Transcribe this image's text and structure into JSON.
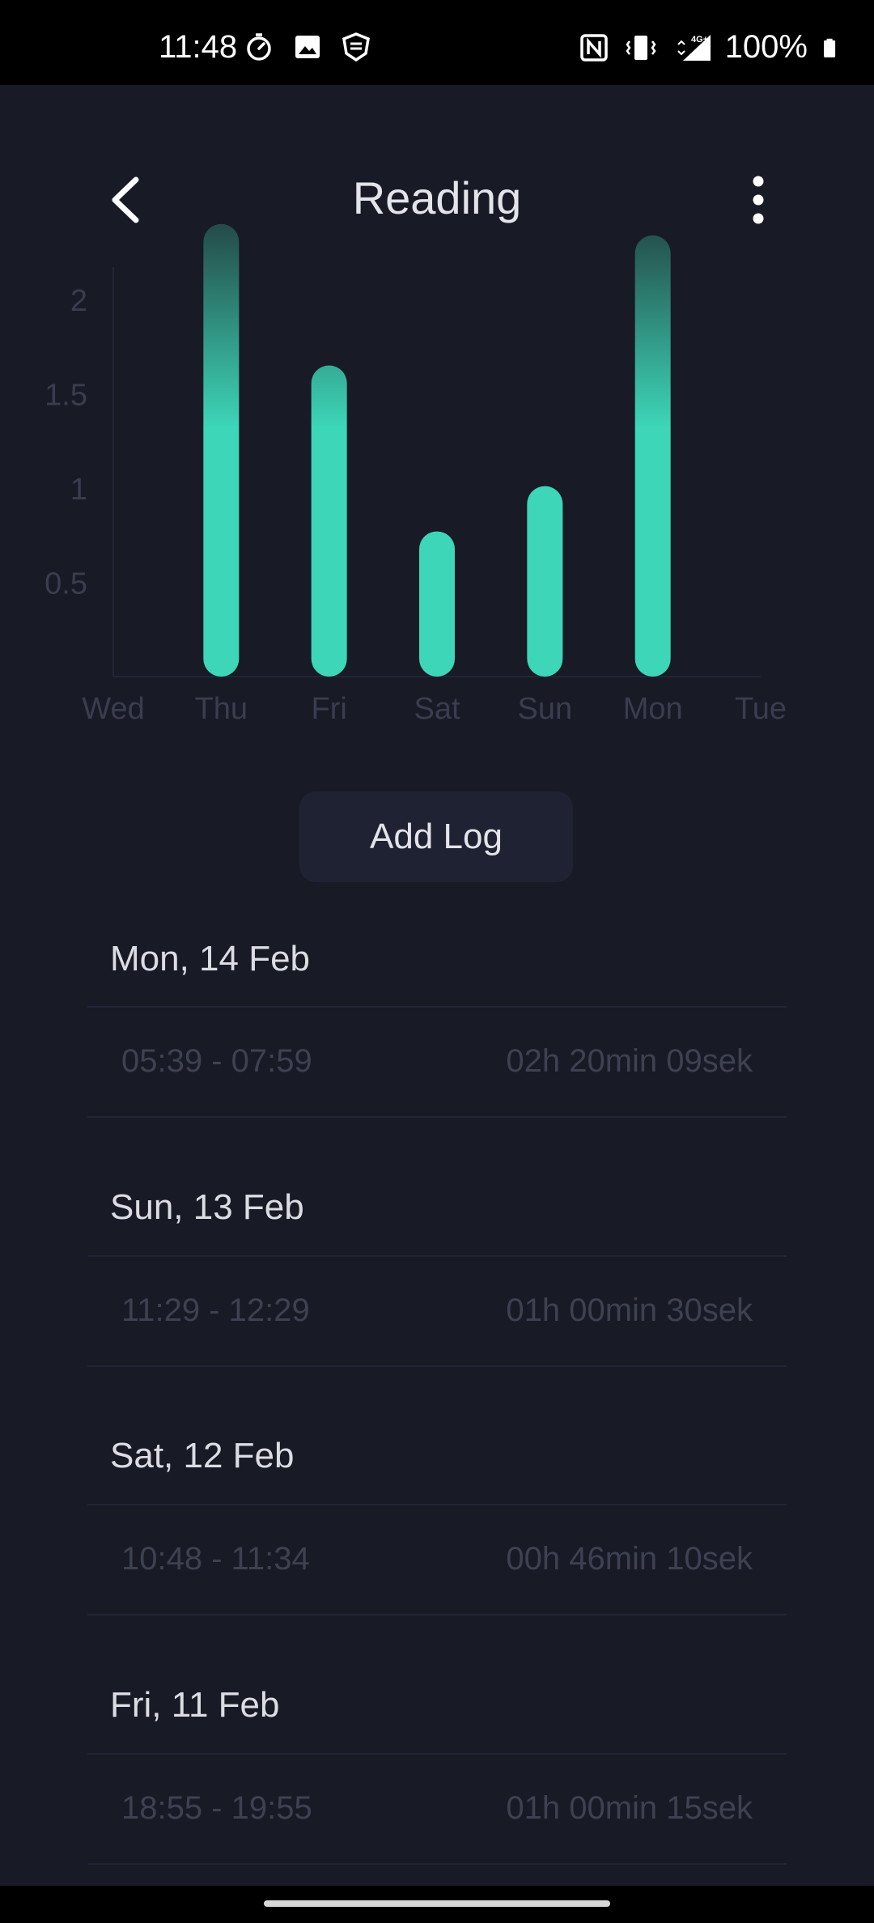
{
  "status_bar": {
    "time": "11:48",
    "battery": "100%",
    "left_icons": [
      "timer-icon",
      "image-icon",
      "app-shield-icon"
    ],
    "right_icons": [
      "nfc-icon",
      "vibrate-icon",
      "4g-signal-icon",
      "battery-icon"
    ]
  },
  "header": {
    "title": "Reading",
    "back_icon": "chevron-left-icon",
    "menu_icon": "more-vertical-icon"
  },
  "chart_data": {
    "type": "bar",
    "categories": [
      "Wed",
      "Thu",
      "Fri",
      "Sat",
      "Sun",
      "Mon",
      "Tue"
    ],
    "values": [
      0,
      2.4,
      1.65,
      0.77,
      1.01,
      2.34,
      0
    ],
    "ytick_labels": [
      "0.5",
      "1",
      "1.5",
      "2"
    ],
    "yticks": [
      0.5,
      1,
      1.5,
      2
    ],
    "ylim": [
      0,
      2.15
    ],
    "bar_color": "#3dd6b8",
    "bar_top_color": "#244a48",
    "axis_color": "#22253a",
    "label_color": "#3a3d4f"
  },
  "actions": {
    "add_log_label": "Add Log"
  },
  "log": [
    {
      "day": "Mon, 14 Feb",
      "range": "05:39 - 07:59",
      "duration": "02h 20min 09sek"
    },
    {
      "day": "Sun, 13 Feb",
      "range": "11:29 - 12:29",
      "duration": "01h 00min 30sek"
    },
    {
      "day": "Sat, 12 Feb",
      "range": "10:48 - 11:34",
      "duration": "00h 46min 10sek"
    },
    {
      "day": "Fri, 11 Feb",
      "range": "18:55 - 19:55",
      "duration": "01h 00min 15sek"
    }
  ]
}
